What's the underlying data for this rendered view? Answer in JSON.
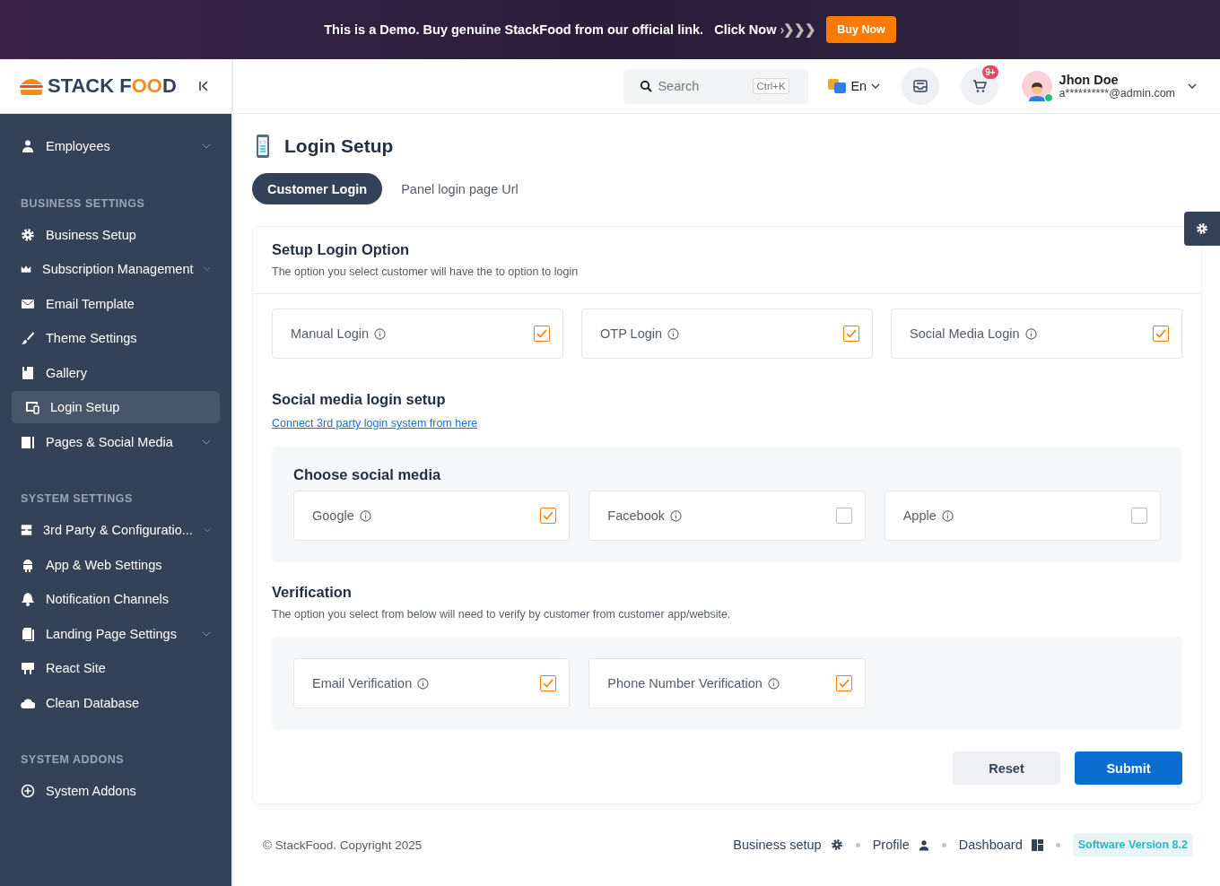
{
  "banner": {
    "message": "This is a Demo. Buy genuine StackFood from our official link.",
    "link": "Click Now",
    "arrows": "›❯❯❯",
    "button": "Buy Now"
  },
  "brand": {
    "logo_text_1": "STACK F",
    "logo_text_2": "OO",
    "logo_text_3": "D"
  },
  "header": {
    "search": {
      "placeholder": "Search",
      "shortcut": "Ctrl+K"
    },
    "language": "En",
    "cart_badge": "9+",
    "user": {
      "name": "Jhon Doe",
      "email": "a**********@admin.com",
      "online": true
    }
  },
  "sidebar": {
    "items": [
      {
        "kind": "item",
        "label": "Employees",
        "caret": true,
        "selected": false
      },
      {
        "kind": "section",
        "label": "BUSINESS SETTINGS"
      },
      {
        "kind": "item",
        "label": "Business Setup",
        "caret": false,
        "selected": false
      },
      {
        "kind": "item",
        "label": "Subscription Management",
        "caret": true,
        "selected": false
      },
      {
        "kind": "item",
        "label": "Email Template",
        "caret": false,
        "selected": false
      },
      {
        "kind": "item",
        "label": "Theme Settings",
        "caret": false,
        "selected": false
      },
      {
        "kind": "item",
        "label": "Gallery",
        "caret": false,
        "selected": false
      },
      {
        "kind": "item",
        "label": "Login Setup",
        "caret": false,
        "selected": true
      },
      {
        "kind": "item",
        "label": "Pages & Social Media",
        "caret": true,
        "selected": false
      },
      {
        "kind": "section",
        "label": "SYSTEM SETTINGS"
      },
      {
        "kind": "item",
        "label": "3rd Party & Configuratio...",
        "caret": true,
        "selected": false
      },
      {
        "kind": "item",
        "label": "App & Web Settings",
        "caret": false,
        "selected": false
      },
      {
        "kind": "item",
        "label": "Notification Channels",
        "caret": false,
        "selected": false
      },
      {
        "kind": "item",
        "label": "Landing Page Settings",
        "caret": true,
        "selected": false
      },
      {
        "kind": "item",
        "label": "React Site",
        "caret": false,
        "selected": false
      },
      {
        "kind": "item",
        "label": "Clean Database",
        "caret": false,
        "selected": false
      },
      {
        "kind": "section",
        "label": "SYSTEM ADDONS"
      },
      {
        "kind": "item",
        "label": "System Addons",
        "caret": false,
        "selected": false
      }
    ]
  },
  "page": {
    "title": "Login Setup",
    "tabs": [
      {
        "label": "Customer Login",
        "selected": true
      },
      {
        "label": "Panel login page Url",
        "selected": false
      }
    ],
    "setup": {
      "title": "Setup Login Option",
      "description": "The option you select customer will have the to option to login",
      "options": [
        {
          "label": "Manual Login",
          "checked": true
        },
        {
          "label": "OTP Login",
          "checked": true
        },
        {
          "label": "Social Media Login",
          "checked": true
        }
      ]
    },
    "social": {
      "title": "Social media login setup",
      "link": "Connect 3rd party login system from here",
      "box_title": "Choose social media",
      "options": [
        {
          "label": "Google",
          "checked": true
        },
        {
          "label": "Facebook",
          "checked": false
        },
        {
          "label": "Apple",
          "checked": false
        }
      ]
    },
    "verification": {
      "title": "Verification",
      "description": "The option you select from below will need to verify by customer from customer app/website.",
      "options": [
        {
          "label": "Email Verification",
          "checked": true
        },
        {
          "label": "Phone Number Verification",
          "checked": true
        }
      ]
    },
    "buttons": {
      "reset": "Reset",
      "submit": "Submit"
    }
  },
  "footer": {
    "copyright": "© StackFood. Copyright 2025",
    "links": [
      {
        "label": "Business setup"
      },
      {
        "label": "Profile"
      },
      {
        "label": "Dashboard"
      }
    ],
    "version": "Software Version 8.2"
  }
}
